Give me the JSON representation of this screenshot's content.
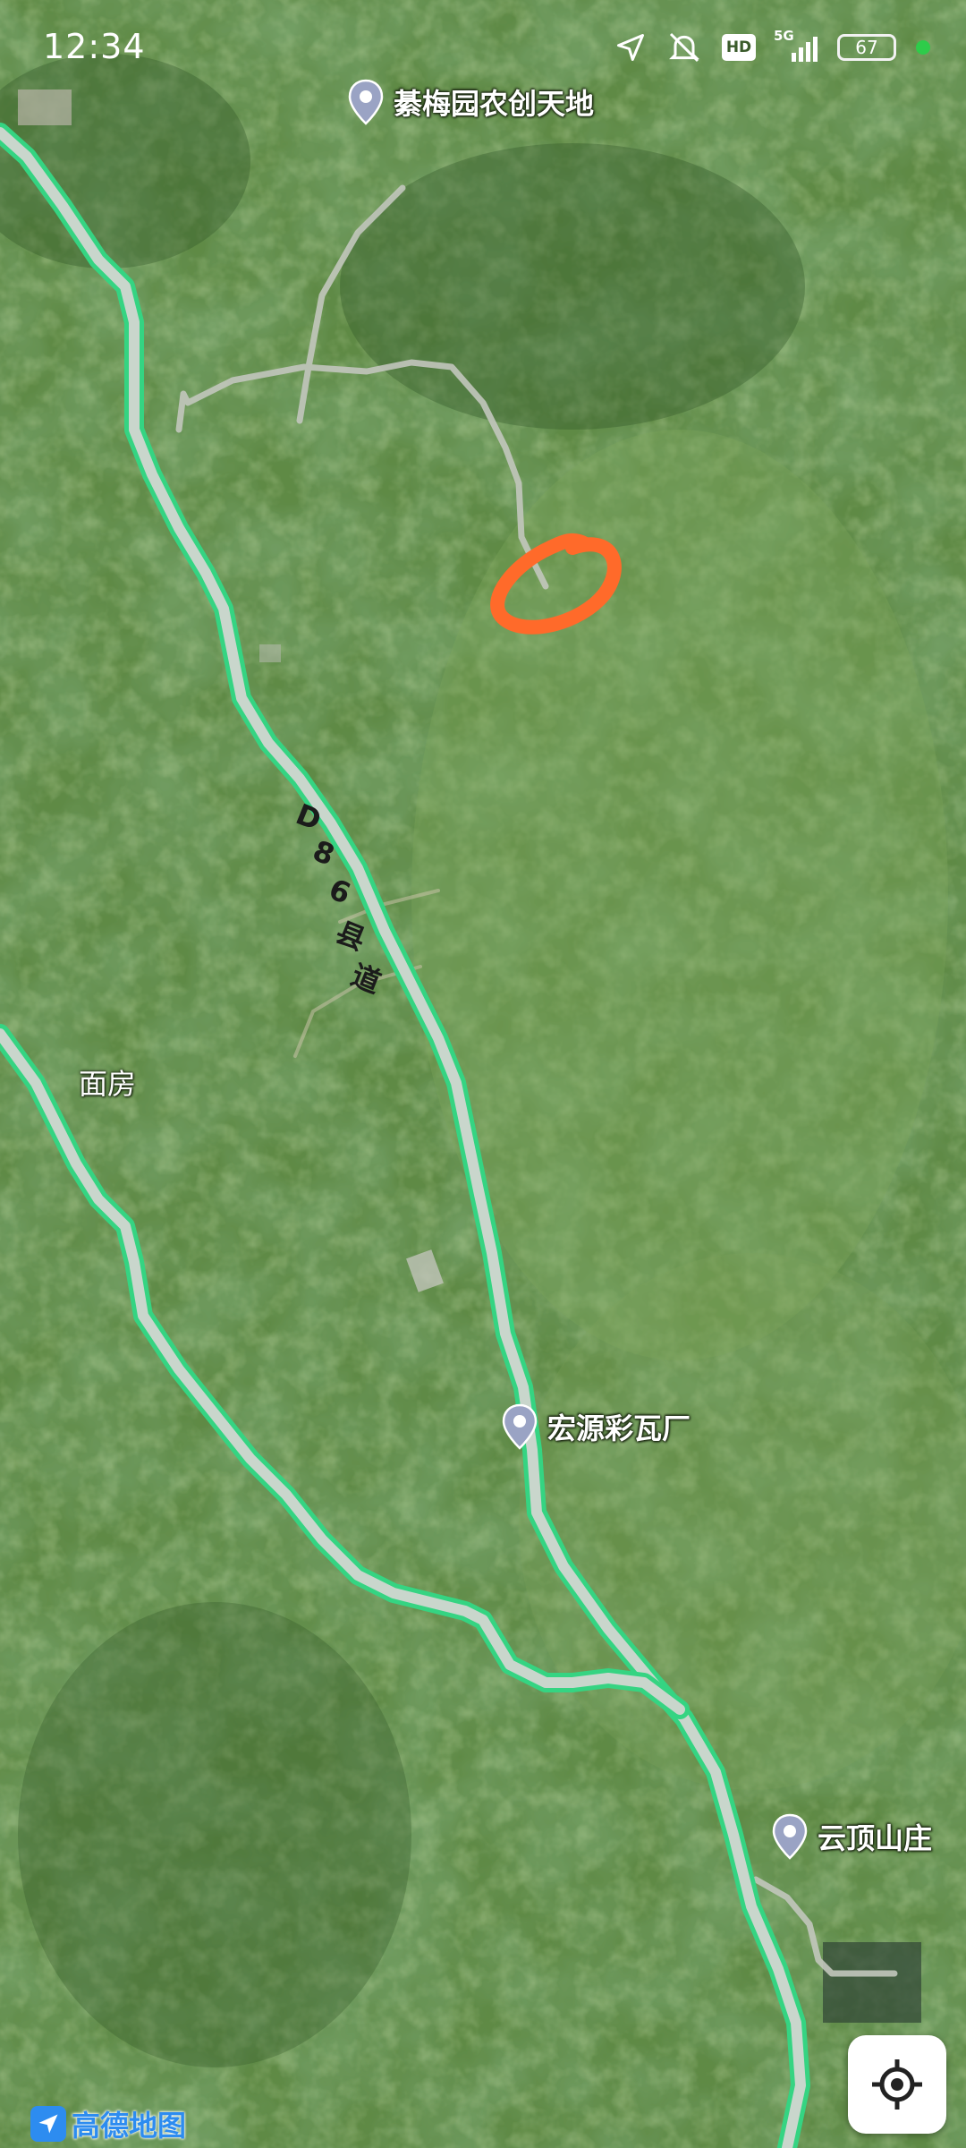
{
  "status_bar": {
    "time": "12:34",
    "network": "5G",
    "hd": "HD",
    "battery": "67"
  },
  "map": {
    "type": "satellite",
    "pois": [
      {
        "name": "綦梅园农创天地"
      },
      {
        "name": "宏源彩瓦厂"
      },
      {
        "name": "云顶山庄"
      }
    ],
    "area_labels": [
      {
        "name": "面房"
      }
    ],
    "road_label": [
      "D",
      "8",
      "6",
      "县",
      "道"
    ],
    "highlight_color": "#ff6a2a",
    "road_color": "#35d482",
    "road_core_color": "#c9d6cc"
  },
  "branding": {
    "logo_text": "高德地图"
  },
  "controls": {
    "locate_icon": "locate-crosshair-icon"
  }
}
